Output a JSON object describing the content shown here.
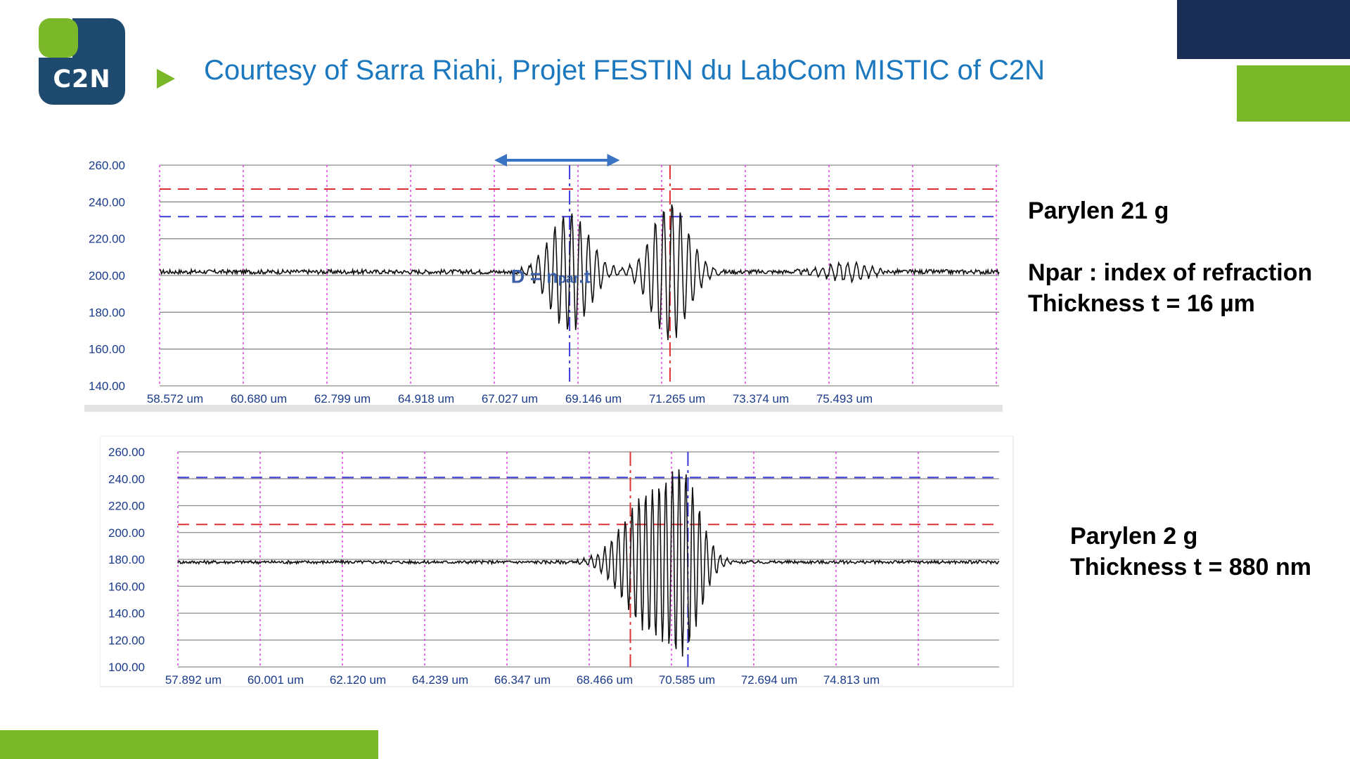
{
  "slide": {
    "title": "Courtesy of Sarra Riahi, Projet FESTIN du LabCom MISTIC of C2N",
    "logo_text": "C2N",
    "colors": {
      "navy": "#1a2e55",
      "green": "#7ab829",
      "title_blue": "#1b78bf",
      "logo_blue": "#1f4a70"
    }
  },
  "annotations": {
    "top": [
      "Parylen 21 g",
      "",
      "Npar : index of refraction",
      "Thickness  t = 16 µm"
    ],
    "bottom": [
      "Parylen 2 g",
      "Thickness t = 880 nm"
    ]
  },
  "chart_data": [
    {
      "type": "line",
      "ylim": [
        140,
        260
      ],
      "yticks": [
        "260.00",
        "240.00",
        "220.00",
        "200.00",
        "180.00",
        "160.00",
        "140.00"
      ],
      "xticks": [
        "58.572 um",
        "60.680 um",
        "62.799 um",
        "64.918 um",
        "67.027 um",
        "69.146 um",
        "71.265 um",
        "73.374 um",
        "75.493 um"
      ],
      "baseline": 202,
      "threshold_lines": [
        {
          "y": 247,
          "color": "#e03030"
        },
        {
          "y": 232,
          "color": "#3a3ad8"
        }
      ],
      "markers": [
        {
          "at": 4.9,
          "color": "#3a3ad8"
        },
        {
          "at": 6.1,
          "color": "#e03030"
        }
      ],
      "arrow": {
        "from": 4.0,
        "to": 5.5,
        "color": "#3a72c4"
      },
      "formula": {
        "main": "D = n",
        "sub": "par",
        "tail": ".t"
      },
      "bursts": [
        {
          "center": 4.9,
          "amp": 33,
          "width": 0.32,
          "freq": 10
        },
        {
          "center": 6.1,
          "amp": 38,
          "width": 0.3,
          "freq": 10
        },
        {
          "center": 8.2,
          "amp": 5,
          "width": 0.35,
          "freq": 10
        }
      ]
    },
    {
      "type": "line",
      "ylim": [
        100,
        260
      ],
      "yticks": [
        "260.00",
        "240.00",
        "220.00",
        "200.00",
        "180.00",
        "160.00",
        "140.00",
        "120.00",
        "100.00"
      ],
      "xticks": [
        "57.892 um",
        "60.001 um",
        "62.120 um",
        "64.239 um",
        "66.347 um",
        "68.466 um",
        "70.585 um",
        "72.694 um",
        "74.813 um"
      ],
      "baseline": 178,
      "threshold_lines": [
        {
          "y": 241,
          "color": "#3a3ad8"
        },
        {
          "y": 206,
          "color": "#e03030"
        }
      ],
      "markers": [
        {
          "at": 5.5,
          "color": "#e03030"
        },
        {
          "at": 6.2,
          "color": "#3a3ad8"
        }
      ],
      "bursts": [
        {
          "center": 5.75,
          "amp": 52,
          "width": 0.45,
          "freq": 12
        },
        {
          "center": 6.15,
          "amp": 58,
          "width": 0.28,
          "freq": 12
        }
      ]
    }
  ]
}
